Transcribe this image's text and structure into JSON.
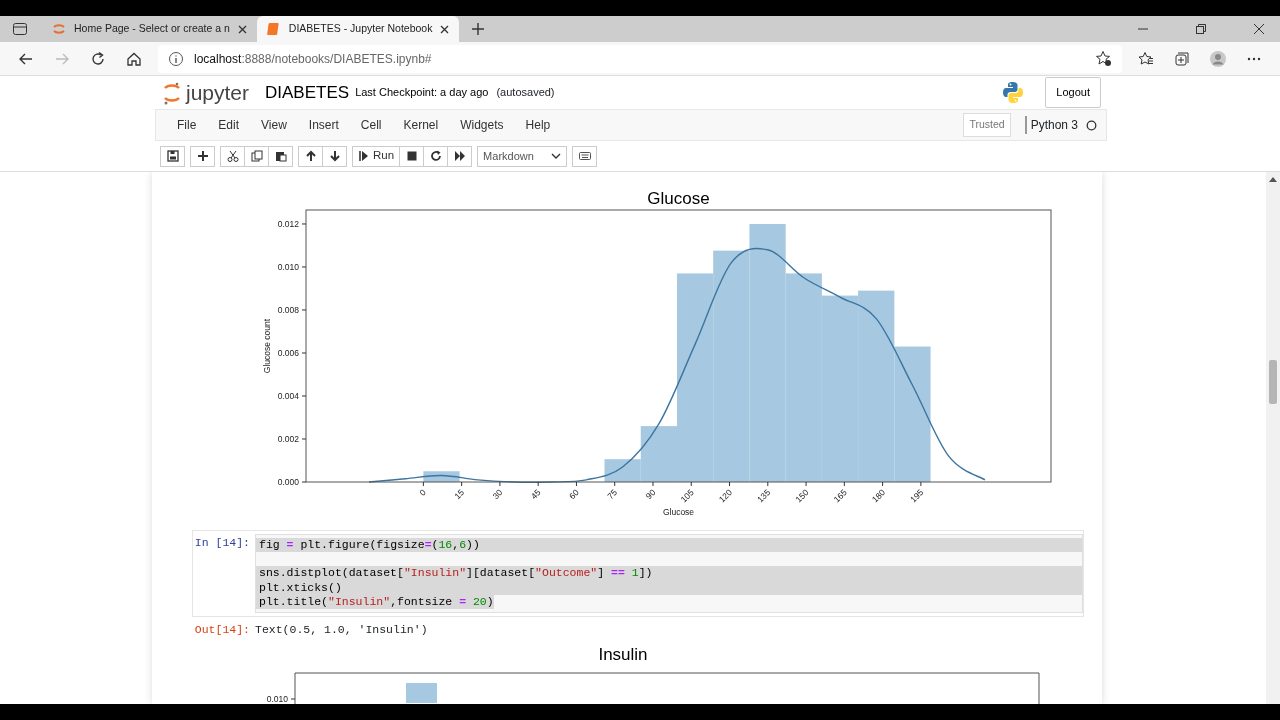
{
  "browser": {
    "tabs": [
      {
        "title": "Home Page - Select or create a n",
        "selected": false
      },
      {
        "title": "DIABETES - Jupyter Notebook",
        "selected": true
      }
    ],
    "url": {
      "host": "localhost",
      "rest": ":8888/notebooks/DIABETES.ipynb#"
    }
  },
  "header": {
    "logo": "jupyter",
    "notebook_name": "DIABETES",
    "checkpoint": "Last Checkpoint: a day ago",
    "autosave": "(autosaved)",
    "logout": "Logout"
  },
  "menu": [
    "File",
    "Edit",
    "View",
    "Insert",
    "Cell",
    "Kernel",
    "Widgets",
    "Help"
  ],
  "trusted": "Trusted",
  "kernel": {
    "name": "Python 3",
    "busy": false
  },
  "toolbar": {
    "run": "Run",
    "cell_type": "Markdown"
  },
  "glucose_output": {
    "chart_data": {
      "type": "bar",
      "title": "Glucose",
      "xlabel": "Glucose",
      "ylabel": "Glucose count",
      "x": [
        -21.3,
        -7.1,
        7.1,
        21.3,
        35.5,
        49.7,
        63.9,
        78.1,
        92.3,
        106.5,
        120.7,
        134.9,
        149.1,
        163.3,
        177.5,
        191.7,
        205.9,
        220.1
      ],
      "series": [
        {
          "color": "#a6c8e0",
          "values": [
            null,
            null,
            0.0005,
            null,
            null,
            null,
            null,
            0.00106,
            0.0026,
            0.0097,
            0.01076,
            0.012,
            0.0097,
            0.00867,
            0.0089,
            0.0063,
            null,
            null
          ]
        },
        {
          "type": "line",
          "color": "#3b75a0",
          "values": [
            0.0,
            0.00015,
            0.0003,
            0.0001,
            0.0,
            0.0,
            0.0001,
            0.0007,
            0.0027,
            0.0064,
            0.0102,
            0.0108,
            0.0095,
            0.0086,
            0.0076,
            0.0045,
            0.0012,
            0.0001
          ]
        }
      ],
      "xlim": [
        -46,
        246
      ],
      "ylim": [
        0,
        0.01265
      ],
      "xticks": [
        0,
        15,
        30,
        45,
        60,
        75,
        90,
        105,
        120,
        135,
        150,
        165,
        180,
        195
      ],
      "yticks": [
        {
          "value": 0,
          "label": "0.000"
        },
        {
          "value": 0.002,
          "label": "0.002"
        },
        {
          "value": 0.004,
          "label": "0.004"
        },
        {
          "value": 0.006,
          "label": "0.006"
        },
        {
          "value": 0.008,
          "label": "0.008"
        },
        {
          "value": 0.01,
          "label": "0.010"
        },
        {
          "value": 0.012,
          "label": "0.012"
        }
      ]
    }
  },
  "code_cell": {
    "prompt": "In [14]:",
    "selected_text": true,
    "lines": [
      {
        "tokens": [
          {
            "kind": "n",
            "t": "fig "
          },
          {
            "kind": "o",
            "t": "="
          },
          {
            "kind": "n",
            "t": " plt.figure(figsize"
          },
          {
            "kind": "o",
            "t": "="
          },
          {
            "kind": "n",
            "t": "("
          },
          {
            "kind": "m",
            "t": "16"
          },
          {
            "kind": "n",
            "t": ","
          },
          {
            "kind": "m",
            "t": "6"
          },
          {
            "kind": "n",
            "t": "))"
          }
        ]
      },
      {
        "gap_before": true,
        "tokens": [
          {
            "kind": "n",
            "t": "sns.distplot(dataset["
          },
          {
            "kind": "s",
            "t": "\"Insulin\""
          },
          {
            "kind": "n",
            "t": "][dataset["
          },
          {
            "kind": "s",
            "t": "\"Outcome\""
          },
          {
            "kind": "n",
            "t": "] "
          },
          {
            "kind": "o",
            "t": "== "
          },
          {
            "kind": "m",
            "t": "1"
          },
          {
            "kind": "n",
            "t": "])"
          }
        ]
      },
      {
        "tokens": [
          {
            "kind": "n",
            "t": "plt.xticks()"
          }
        ]
      },
      {
        "tokens": [
          {
            "kind": "n",
            "t": "plt.title("
          },
          {
            "kind": "s",
            "t": "\"Insulin\""
          },
          {
            "kind": "n",
            "t": ",fontsize "
          },
          {
            "kind": "o",
            "t": "= "
          },
          {
            "kind": "m",
            "t": "20"
          },
          {
            "kind": "n",
            "t": ")"
          }
        ]
      }
    ]
  },
  "out_prompt": "Out[14]:",
  "out_text": "Text(0.5, 1.0, 'Insulin')",
  "insulin_output": {
    "title": "Insulin",
    "ytick": "0.010"
  }
}
